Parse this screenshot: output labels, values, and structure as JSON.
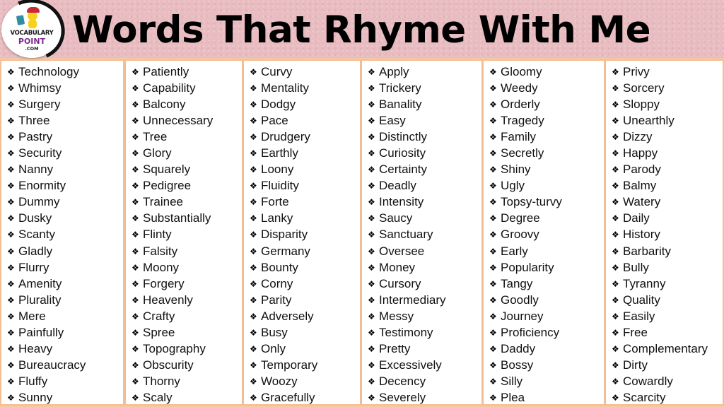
{
  "header": {
    "title": "Words That Rhyme With Me",
    "logo": {
      "line1": "VOCABULARY",
      "line2": "POINT",
      "line3": ".COM"
    }
  },
  "bullet_icon": "❖",
  "colors": {
    "header_bg": "#e8bcc0",
    "border": "#f5bd94",
    "text": "#111111",
    "logo_accent": "#7a2c8a"
  },
  "columns": [
    [
      "Technology",
      "Whimsy",
      "Surgery",
      "Three",
      "Pastry",
      "Security",
      "Nanny",
      "Enormity",
      "Dummy",
      "Dusky",
      "Scanty",
      "Gladly",
      "Flurry",
      "Amenity",
      "Plurality",
      "Mere",
      "Painfully",
      "Heavy",
      "Bureaucracy",
      "Fluffy",
      "Sunny"
    ],
    [
      "Patiently",
      "Capability",
      "Balcony",
      "Unnecessary",
      "Tree",
      "Glory",
      "Squarely",
      "Pedigree",
      "Trainee",
      "Substantially",
      "Flinty",
      "Falsity",
      "Moony",
      "Forgery",
      "Heavenly",
      "Crafty",
      "Spree",
      "Topography",
      "Obscurity",
      "Thorny",
      "Scaly"
    ],
    [
      "Curvy",
      "Mentality",
      "Dodgy",
      "Pace",
      "Drudgery",
      "Earthly",
      "Loony",
      "Fluidity",
      "Forte",
      "Lanky",
      "Disparity",
      "Germany",
      "Bounty",
      "Corny",
      "Parity",
      "Adversely",
      "Busy",
      "Only",
      "Temporary",
      "Woozy",
      "Gracefully"
    ],
    [
      "Apply",
      "Trickery",
      "Banality",
      "Easy",
      "Distinctly",
      "Curiosity",
      "Certainty",
      "Deadly",
      "Intensity",
      "Saucy",
      "Sanctuary",
      "Oversee",
      "Money",
      "Cursory",
      "Intermediary",
      "Messy",
      "Testimony",
      "Pretty",
      "Excessively",
      "Decency",
      "Severely"
    ],
    [
      "Gloomy",
      "Weedy",
      "Orderly",
      "Tragedy",
      "Family",
      "Secretly",
      "Shiny",
      "Ugly",
      "Topsy-turvy",
      "Degree",
      "Groovy",
      "Early",
      "Popularity",
      "Tangy",
      "Goodly",
      "Journey",
      "Proficiency",
      "Daddy",
      "Bossy",
      "Silly",
      "Plea"
    ],
    [
      "Privy",
      "Sorcery",
      "Sloppy",
      "Unearthly",
      "Dizzy",
      "Happy",
      "Parody",
      "Balmy",
      "Watery",
      "Daily",
      "History",
      "Barbarity",
      "Bully",
      "Tyranny",
      "Quality",
      "Easily",
      "Free",
      "Complementary",
      "Dirty",
      "Cowardly",
      "Scarcity"
    ]
  ]
}
